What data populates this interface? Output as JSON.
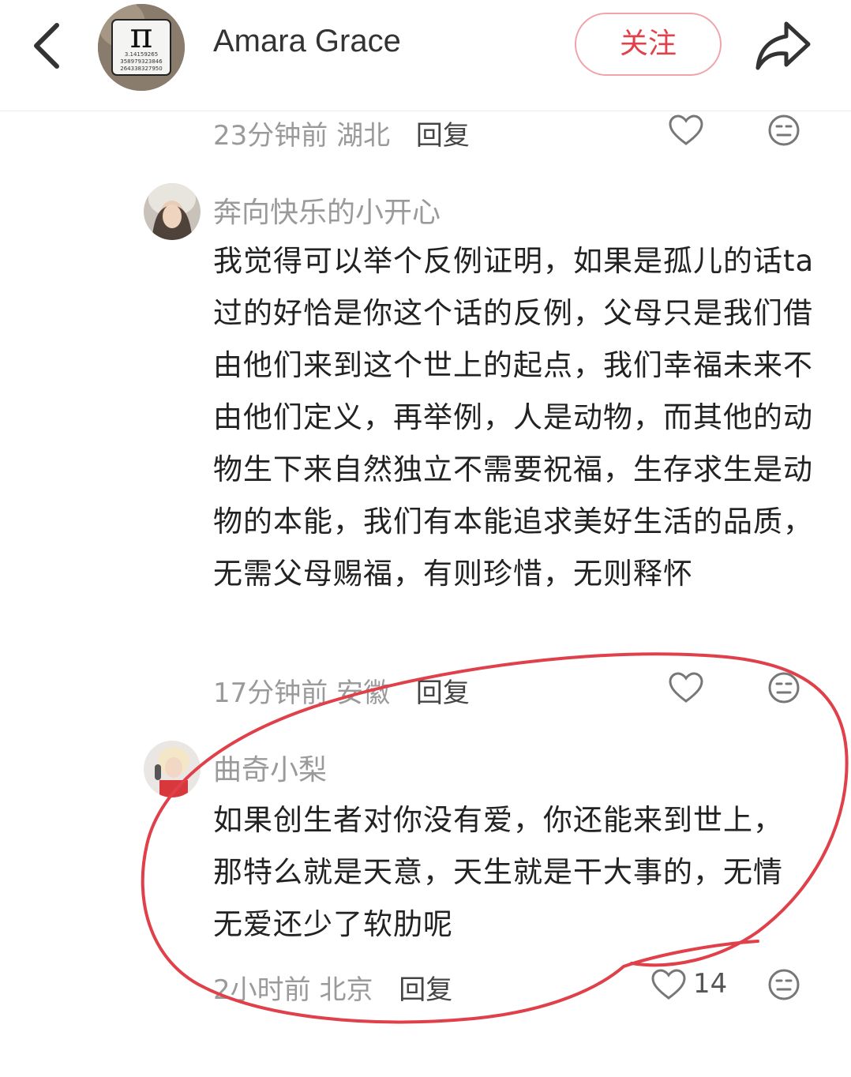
{
  "header": {
    "user_name": "Amara Grace",
    "follow_label": "关注",
    "avatar_pi_symbol": "π",
    "avatar_digits": [
      "3.14159265",
      "358979323846",
      "264338327950"
    ]
  },
  "top_meta": {
    "time": "23分钟前",
    "location": "湖北",
    "reply_label": "回复"
  },
  "comments": [
    {
      "author": "奔向快乐的小开心",
      "text": "我觉得可以举个反例证明，如果是孤儿的话ta过的好恰是你这个话的反例，父母只是我们借由他们来到这个世上的起点，我们幸福未来不由他们定义，再举例，人是动物，而其他的动物生下来自然独立不需要祝福，生存求生是动物的本能，我们有本能追求美好生活的品质，无需父母赐福，有则珍惜，无则释怀",
      "time": "17分钟前",
      "location": "安徽",
      "reply_label": "回复"
    },
    {
      "author": "曲奇小梨",
      "text": "如果创生者对你没有爱，你还能来到世上，那特么就是天意，天生就是干大事的，无情无爱还少了软肋呢",
      "time": "2小时前",
      "location": "北京",
      "reply_label": "回复",
      "likes": "14"
    }
  ],
  "icons": {
    "back": "chevron-left-icon",
    "share": "share-arrow-icon",
    "like": "heart-outline-icon",
    "emoji": "neutral-face-icon"
  },
  "colors": {
    "accent": "#e0414a",
    "follow_border": "#f0a3a8",
    "annotation": "#e0404a",
    "meta_text": "#9a9a9a"
  }
}
